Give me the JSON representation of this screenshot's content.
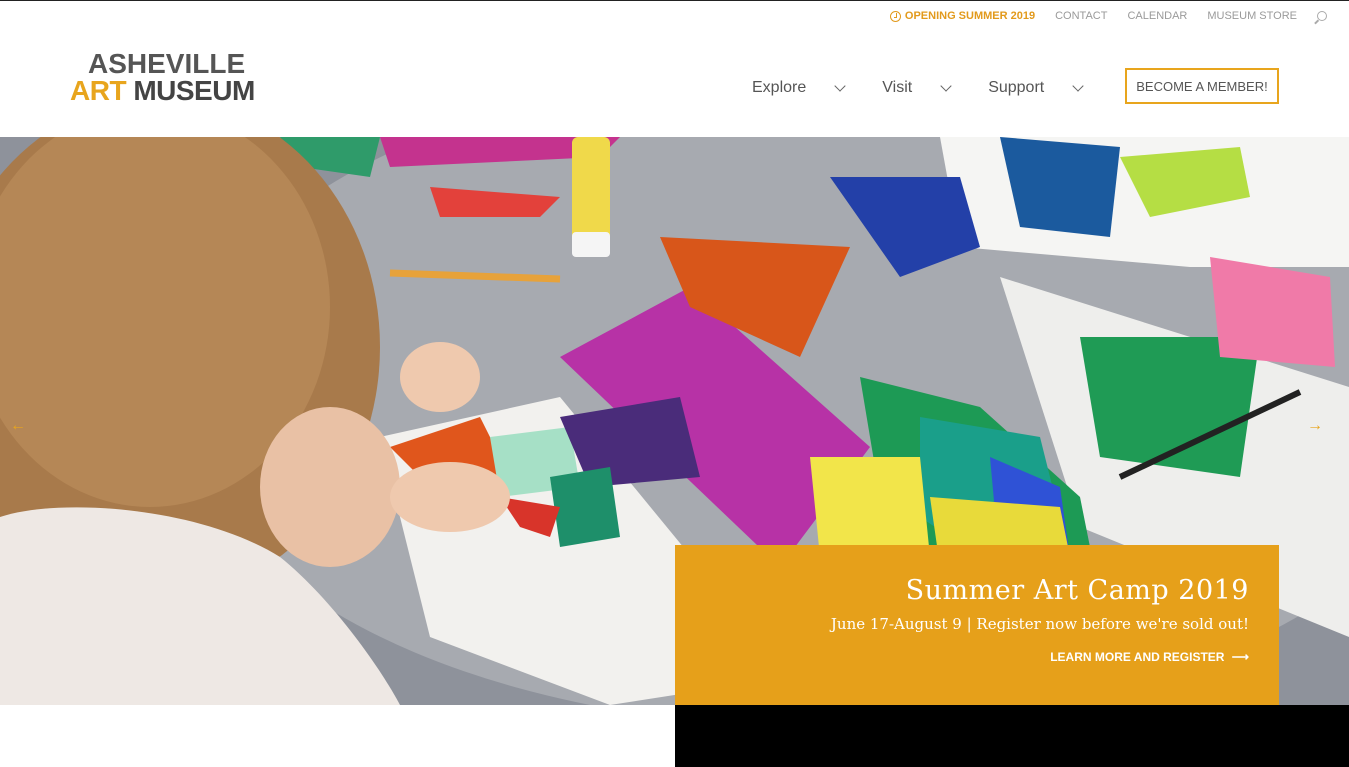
{
  "utility_nav": {
    "opening": "OPENING SUMMER 2019",
    "contact": "CONTACT",
    "calendar": "CALENDAR",
    "store": "MUSEUM STORE"
  },
  "logo": {
    "line1": "ASHEVILLE",
    "art": "ART",
    "museum": "MUSEUM"
  },
  "main_nav": {
    "items": [
      "Explore",
      "Visit",
      "Support"
    ],
    "member_button": "BECOME A MEMBER!"
  },
  "hero": {
    "title": "Summer Art Camp 2019",
    "subtitle": "June 17-August 9 | Register now before we're sold out!",
    "cta": "LEARN MORE AND REGISTER",
    "cta_arrow": "⟶",
    "prev_arrow": "←",
    "next_arrow": "→"
  },
  "colors": {
    "accent": "#e6a01a",
    "text": "#555555"
  }
}
